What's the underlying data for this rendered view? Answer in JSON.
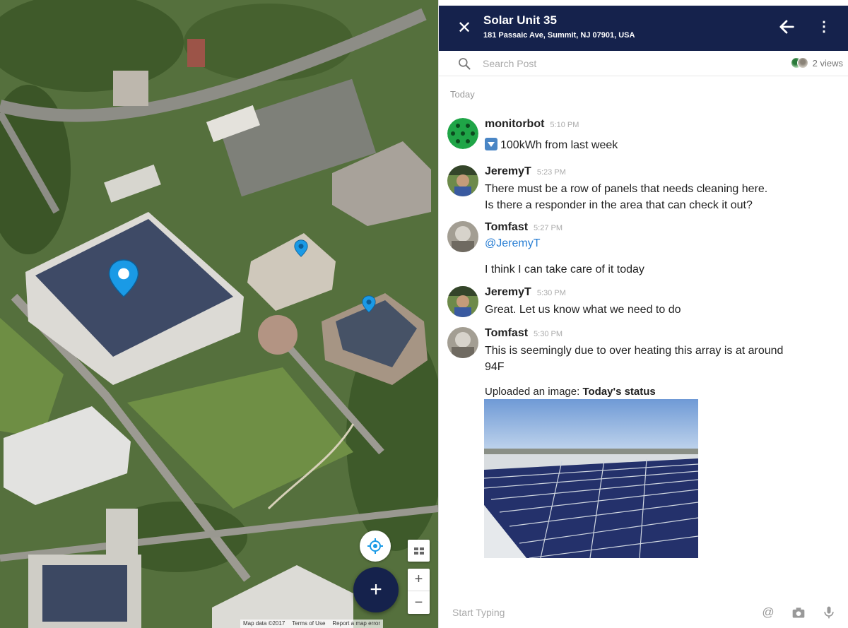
{
  "map": {
    "attribution": [
      "Map data ©2017",
      "Terms of Use",
      "Report a map error"
    ],
    "zoom_in_label": "+",
    "zoom_out_label": "−",
    "fab_label": "+",
    "icons": [
      "location-pin-icon",
      "crosshair-icon",
      "layers-icon",
      "plus-icon"
    ],
    "colors": {
      "pin": "#1a9ae6",
      "fab": "#15224c"
    }
  },
  "header": {
    "title": "Solar Unit 35",
    "address": "181 Passaic Ave, Summit, NJ 07901, USA",
    "close_icon": "close-icon",
    "back_icon": "arrow-back-icon",
    "more_icon": "more-vertical-icon",
    "colors": {
      "bar": "#15224c"
    }
  },
  "search": {
    "placeholder": "Search Post",
    "views_label": "2 views"
  },
  "feed": {
    "day_label": "Today",
    "messages": [
      {
        "author": "monitorbot",
        "time": "5:10 PM",
        "text": "100kWh from last week",
        "icon": "arrow-down-icon"
      },
      {
        "author": "JeremyT",
        "time": "5:23 PM",
        "lines": [
          "There must be a row of panels that needs cleaning here.",
          "Is there a responder in the area that can check it out?"
        ]
      },
      {
        "author": "Tomfast",
        "time": "5:27 PM",
        "mention": "@JeremyT",
        "text": "I think I can take care of it today"
      },
      {
        "author": "JeremyT",
        "time": "5:30 PM",
        "text": "Great. Let us know what we need to do"
      },
      {
        "author": "Tomfast",
        "time": "5:30 PM",
        "lines": [
          "This is seemingly due to over heating this array is at around",
          "94F"
        ],
        "upload_prefix": "Uploaded an image: ",
        "upload_title": "Today's status"
      }
    ]
  },
  "composer": {
    "placeholder": "Start Typing",
    "icons": [
      "at-sign-icon",
      "camera-icon",
      "microphone-icon"
    ]
  }
}
